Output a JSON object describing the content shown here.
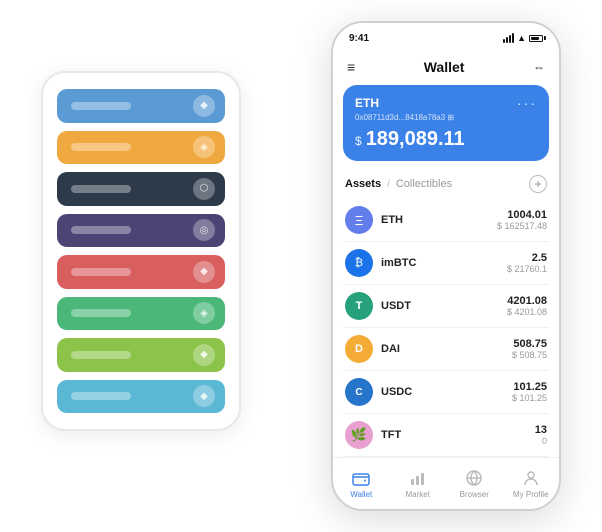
{
  "scene": {
    "background_cards": [
      {
        "color_class": "row-blue",
        "icon": "◆"
      },
      {
        "color_class": "row-orange",
        "icon": "◈"
      },
      {
        "color_class": "row-dark",
        "icon": "⬡"
      },
      {
        "color_class": "row-purple",
        "icon": "◎"
      },
      {
        "color_class": "row-red",
        "icon": "◆"
      },
      {
        "color_class": "row-green",
        "icon": "◈"
      },
      {
        "color_class": "row-light-green",
        "icon": "◆"
      },
      {
        "color_class": "row-light-blue",
        "icon": "◆"
      }
    ]
  },
  "phone": {
    "status": {
      "time": "9:41",
      "signal": true,
      "wifi": true,
      "battery": true
    },
    "nav": {
      "menu_icon": "≡",
      "title": "Wallet",
      "expand_icon": "⇔"
    },
    "eth_card": {
      "label": "ETH",
      "more": "···",
      "address": "0x08711d3d...8418a78a3  ⊞",
      "dollar_sign": "$",
      "balance": "189,089.11"
    },
    "assets_header": {
      "tab_active": "Assets",
      "divider": "/",
      "tab_inactive": "Collectibles",
      "add_icon": "+"
    },
    "assets": [
      {
        "symbol": "ETH",
        "amount": "1004.01",
        "usd": "$ 162517.48",
        "icon_color": "#627eea",
        "icon_text": "Ξ"
      },
      {
        "symbol": "imBTC",
        "amount": "2.5",
        "usd": "$ 21760.1",
        "icon_color": "#1a73e8",
        "icon_text": "₿"
      },
      {
        "symbol": "USDT",
        "amount": "4201.08",
        "usd": "$ 4201.08",
        "icon_color": "#26a17b",
        "icon_text": "T"
      },
      {
        "symbol": "DAI",
        "amount": "508.75",
        "usd": "$ 508.75",
        "icon_color": "#f5ac37",
        "icon_text": "D"
      },
      {
        "symbol": "USDC",
        "amount": "101.25",
        "usd": "$ 101.25",
        "icon_color": "#2775ca",
        "icon_text": "C"
      },
      {
        "symbol": "TFT",
        "amount": "13",
        "usd": "0",
        "icon_color": "#cc88bb",
        "icon_text": "🌿"
      }
    ],
    "bottom_nav": [
      {
        "id": "wallet",
        "label": "Wallet",
        "active": true
      },
      {
        "id": "market",
        "label": "Market",
        "active": false
      },
      {
        "id": "browser",
        "label": "Browser",
        "active": false
      },
      {
        "id": "profile",
        "label": "My Profile",
        "active": false
      }
    ]
  }
}
